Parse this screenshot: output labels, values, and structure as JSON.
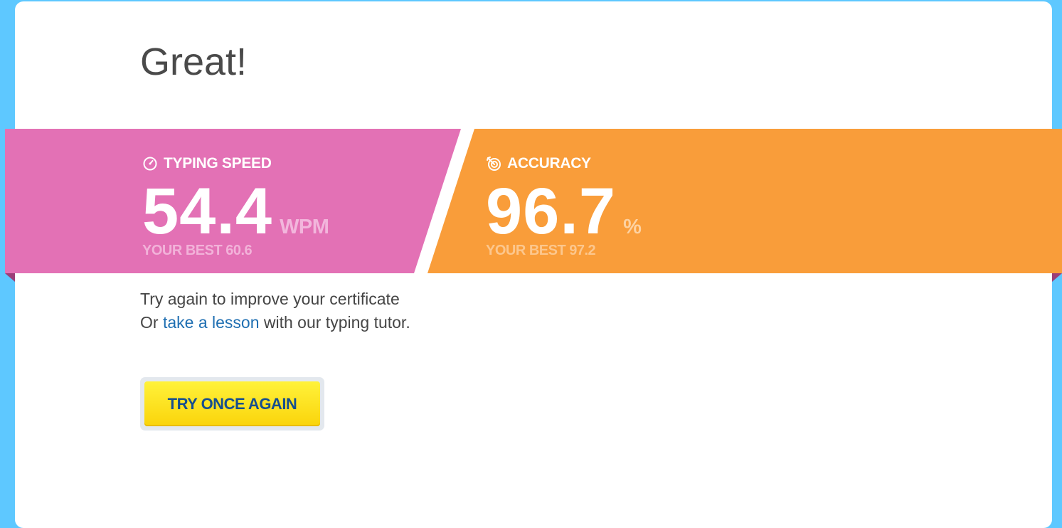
{
  "result": {
    "heading": "Great!"
  },
  "stats": {
    "speed": {
      "label": "TYPING SPEED",
      "icon": "speedometer-icon",
      "value": "54.4",
      "unit": "WPM",
      "best": "YOUR BEST 60.6",
      "color": "#e371b5"
    },
    "accuracy": {
      "label": "ACCURACY",
      "icon": "target-icon",
      "value": "96.7",
      "unit": "%",
      "best": "YOUR BEST 97.2",
      "color": "#f99d3a"
    }
  },
  "message": {
    "line1": "Try again to improve your certificate",
    "line2_prefix": "Or ",
    "line2_link": "take a lesson",
    "line2_suffix": " with our typing tutor."
  },
  "actions": {
    "try_again_label": "TRY ONCE AGAIN",
    "button_color": "#fae622",
    "link_color": "#1f6fb2"
  },
  "background": {
    "color": "#5ec8ff"
  }
}
